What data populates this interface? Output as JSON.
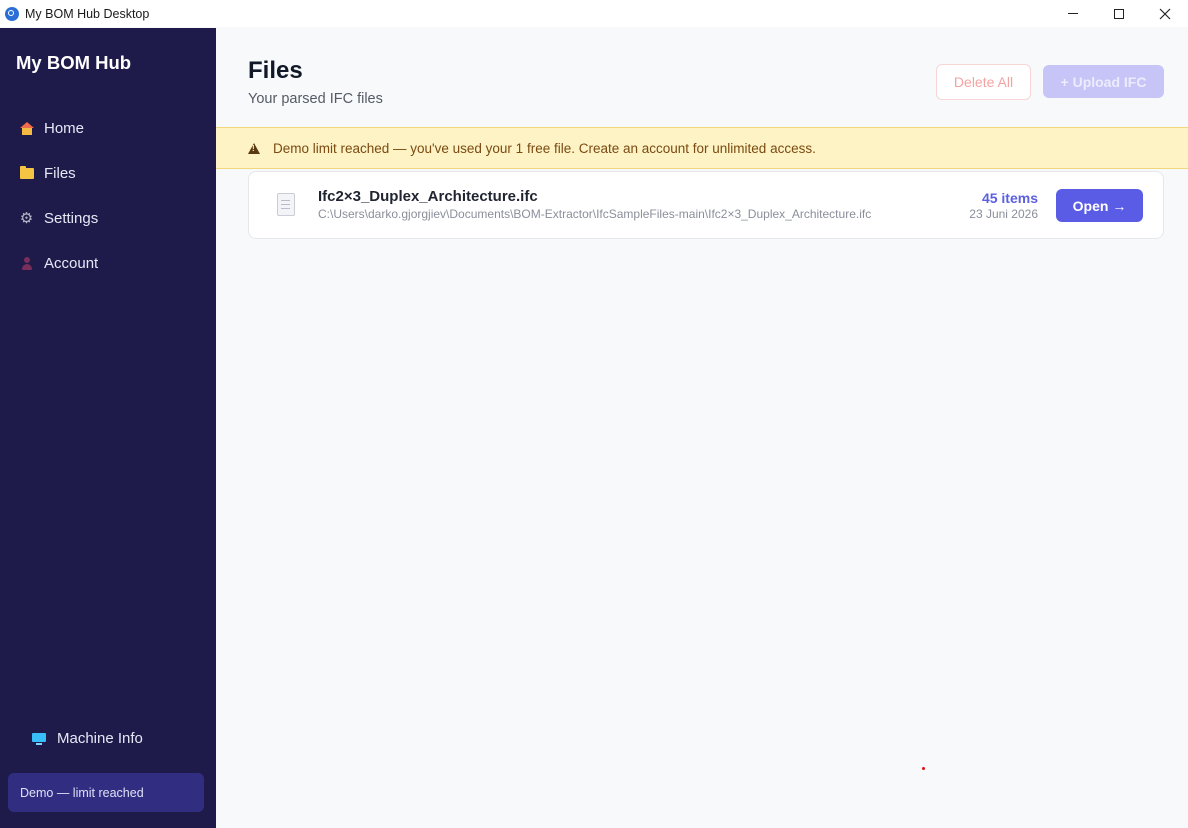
{
  "window": {
    "title": "My BOM Hub Desktop",
    "controls": [
      "minimize",
      "maximize",
      "close"
    ]
  },
  "sidebar": {
    "brand": "My BOM Hub",
    "items": [
      {
        "label": "Home",
        "icon": "home-icon"
      },
      {
        "label": "Files",
        "icon": "folder-icon"
      },
      {
        "label": "Settings",
        "icon": "gear-icon"
      },
      {
        "label": "Account",
        "icon": "person-icon"
      }
    ],
    "machine_info": {
      "label": "Machine Info",
      "icon": "monitor-icon"
    },
    "demo_status": "Demo — limit reached"
  },
  "header": {
    "title": "Files",
    "subtitle": "Your parsed IFC files",
    "delete_all_label": "Delete All",
    "upload_label": "+ Upload IFC"
  },
  "banner": {
    "icon": "warning-icon",
    "text": "Demo limit reached — you've used your 1 free file. Create an account for unlimited access."
  },
  "files": [
    {
      "name": "Ifc2×3_Duplex_Architecture.ifc",
      "path": "C:\\Users\\darko.gjorgjiev\\Documents\\BOM-Extractor\\IfcSampleFiles-main\\Ifc2×3_Duplex_Architecture.ifc",
      "items": "45 items",
      "date": "23 Juni 2026",
      "open_label": "Open →"
    }
  ],
  "colors": {
    "sidebar_bg": "#1e1b4b",
    "accent": "#5b5ce6",
    "banner_bg": "#fdf3c4",
    "banner_text": "#7a4a12"
  }
}
